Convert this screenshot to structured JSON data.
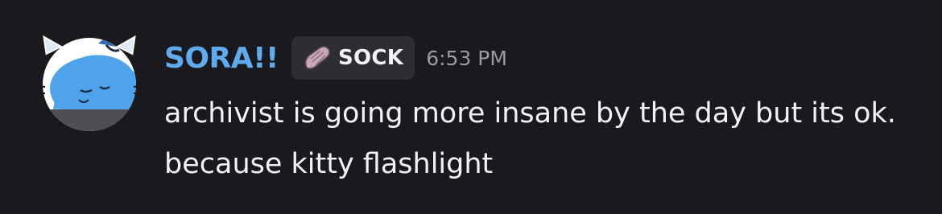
{
  "message": {
    "username": "SORA!!",
    "tag": {
      "icon": "sock-icon",
      "label": "SOCK"
    },
    "timestamp": "6:53 PM",
    "content": "archivist is going more insane by the day but its ok. because kitty flashlight"
  },
  "colors": {
    "background": "#1a191e",
    "username": "#5fabef",
    "tag_background": "#2e2d33",
    "text": "#f2f3f5",
    "timestamp": "#9a9aa3"
  }
}
